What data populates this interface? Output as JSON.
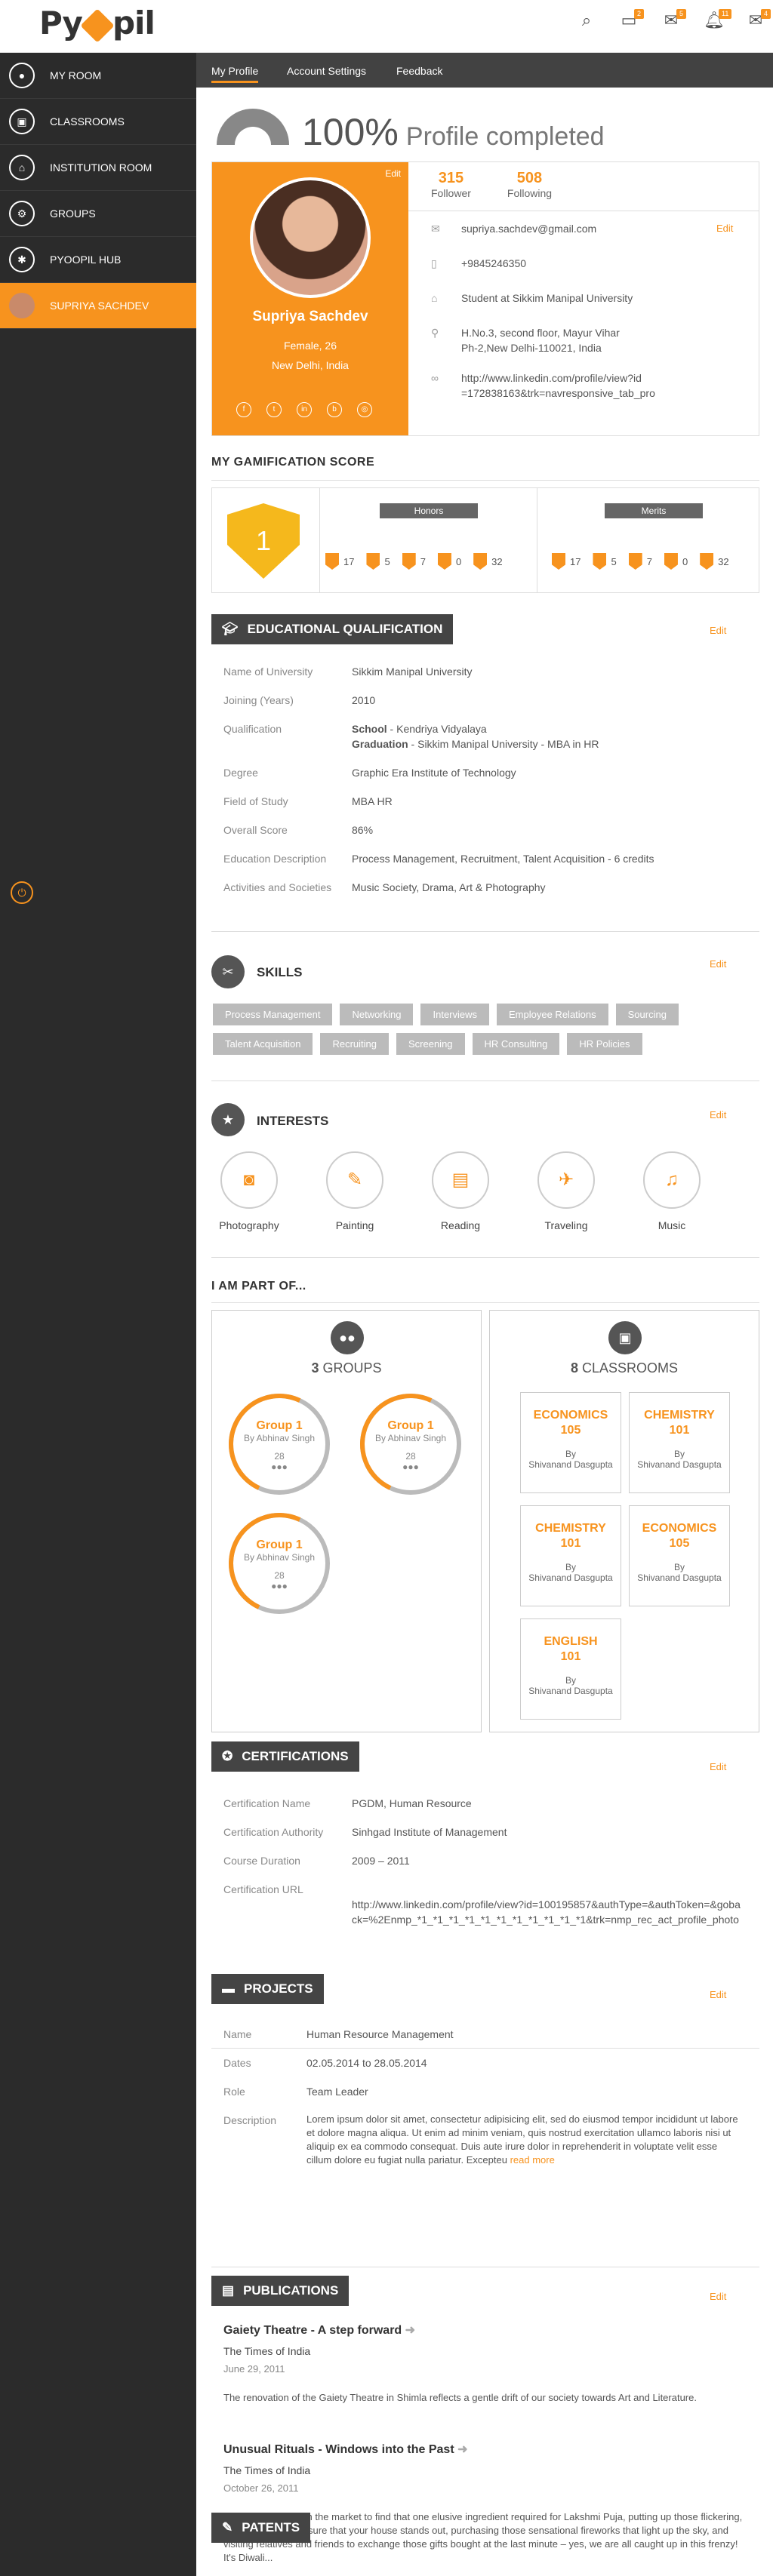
{
  "app": {
    "logo": "Pyoopil"
  },
  "topbar": {
    "badges": [
      "2",
      "5",
      "11",
      "4"
    ]
  },
  "sidebar": {
    "items": [
      {
        "label": "MY ROOM"
      },
      {
        "label": "CLASSROOMS"
      },
      {
        "label": "INSTITUTION ROOM"
      },
      {
        "label": "GROUPS"
      },
      {
        "label": "PYOOPIL HUB"
      },
      {
        "label": "SUPRIYA SACHDEV"
      }
    ]
  },
  "tabs": [
    "My Profile",
    "Account Settings",
    "Feedback"
  ],
  "completion": {
    "percent": "100%",
    "label": "Profile completed",
    "value": 100
  },
  "profile": {
    "name": "Supriya Sachdev",
    "gender_age": "Female, 26",
    "location": "New Delhi, India",
    "edit": "Edit",
    "followers": "315",
    "followers_label": "Follower",
    "following": "508",
    "following_label": "Following",
    "email": "supriya.sachdev@gmail.com",
    "phone": "+9845246350",
    "edu": "Student at Sikkim Manipal University",
    "address1": "H.No.3, second floor, Mayur Vihar",
    "address2": "Ph-2,New Delhi-110021, India",
    "url1": "http://www.linkedin.com/profile/view?id",
    "url2": "=172838163&trk=navresponsive_tab_pro",
    "contact_edit": "Edit"
  },
  "gamification": {
    "title": "MY GAMIFICATION SCORE",
    "level": "1",
    "honors_title": "Honors",
    "merits_title": "Merits",
    "honors": [
      "17",
      "5",
      "7",
      "0",
      "32"
    ],
    "merits": [
      "17",
      "5",
      "7",
      "0",
      "32"
    ]
  },
  "education": {
    "title": "EDUCATIONAL QUALIFICATION",
    "edit": "Edit",
    "rows": [
      {
        "k": "Name of University",
        "v": "Sikkim Manipal University"
      },
      {
        "k": "Joining (Years)",
        "v": "2010"
      },
      {
        "k": "Qualification",
        "v1b": "School",
        "v1": " - Kendriya Vidyalaya",
        "v2b": "Graduation",
        "v2": " - Sikkim Manipal University - MBA in HR"
      },
      {
        "k": "Degree",
        "v": "Graphic Era Institute of Technology"
      },
      {
        "k": "Field of Study",
        "v": "MBA HR"
      },
      {
        "k": "Overall Score",
        "v": "86%"
      },
      {
        "k": "Education Description",
        "v": "Process Management, Recruitment, Talent Acquisition - 6 credits"
      },
      {
        "k": "Activities and Societies",
        "v": "Music Society, Drama, Art & Photography"
      }
    ]
  },
  "skills": {
    "title": "SKILLS",
    "edit": "Edit",
    "items": [
      "Process Management",
      "Networking",
      "Interviews",
      "Employee Relations",
      "Sourcing",
      "Talent Acquisition",
      "Recruiting",
      "Screening",
      "HR Consulting",
      "HR Policies"
    ]
  },
  "interests": {
    "title": "INTERESTS",
    "edit": "Edit",
    "items": [
      "Photography",
      "Painting",
      "Reading",
      "Traveling",
      "Music"
    ]
  },
  "partof": {
    "title": "I AM PART OF...",
    "groups_count": "3",
    "groups_label": "GROUPS",
    "classrooms_count": "8",
    "classrooms_label": "CLASSROOMS",
    "group_name": "Group 1",
    "group_by": "By Abhinav Singh",
    "group_members": "28",
    "classrooms": [
      {
        "n": "ECONOMICS",
        "c": "105"
      },
      {
        "n": "CHEMISTRY",
        "c": "101"
      },
      {
        "n": "CHEMISTRY",
        "c": "101"
      },
      {
        "n": "ECONOMICS",
        "c": "105"
      },
      {
        "n": "ENGLISH",
        "c": "101"
      }
    ],
    "by": "By",
    "teacher": "Shivanand Dasgupta"
  },
  "certifications": {
    "title": "CERTIFICATIONS",
    "edit": "Edit",
    "rows": [
      {
        "k": "Certification Name",
        "v": "PGDM, Human Resource"
      },
      {
        "k": "Certification Authority",
        "v": "Sinhgad Institute of Management"
      },
      {
        "k": "Course Duration",
        "v": "2009 – 2011"
      },
      {
        "k": "Certification URL",
        "v": "http://www.linkedin.com/profile/view?id=100195857&authType=&authToken=&goback=%2Enmp_*1_*1_*1_*1_*1_*1_*1_*1_*1_*1_*1&trk=nmp_rec_act_profile_photo"
      }
    ]
  },
  "projects": {
    "title": "PROJECTS",
    "edit": "Edit",
    "rows": [
      {
        "k": "Name",
        "v": "Human Resource Management"
      },
      {
        "k": "Dates",
        "v": "02.05.2014 to 28.05.2014"
      },
      {
        "k": "Role",
        "v": "Team Leader"
      }
    ],
    "desc_k": "Description",
    "desc": "Lorem ipsum dolor sit amet, consectetur adipisicing elit, sed do eiusmod tempor incididunt ut labore et dolore magna aliqua. Ut enim ad minim veniam, quis nostrud exercitation ullamco laboris nisi ut aliquip ex ea commodo consequat. Duis aute irure dolor in reprehenderit in voluptate velit esse cillum dolore eu fugiat nulla pariatur. Excepteu",
    "read_more": "read more"
  },
  "publications": {
    "title": "PUBLICATIONS",
    "edit": "Edit",
    "items": [
      {
        "t": "Gaiety Theatre - A step forward",
        "s": "The Times of India",
        "d": "June 29, 2011",
        "b": "The renovation of the Gaiety Theatre in Shimla reflects a gentle drift of our society towards Art and Literature."
      },
      {
        "t": "Unusual Rituals - Windows into the Past",
        "s": "The Times of India",
        "d": "October 26, 2011",
        "b": "Rummaging through the market to find that one elusive ingredient required for Lakshmi Puja, putting up those flickering, dancing lights to ensure that your house stands out, purchasing those sensational fireworks that light up the sky, and visiting relatives and friends to exchange those gifts bought at the last minute – yes, we are all caught up in this frenzy! It's Diwali..."
      }
    ]
  },
  "patents": {
    "title": "PATENTS"
  }
}
